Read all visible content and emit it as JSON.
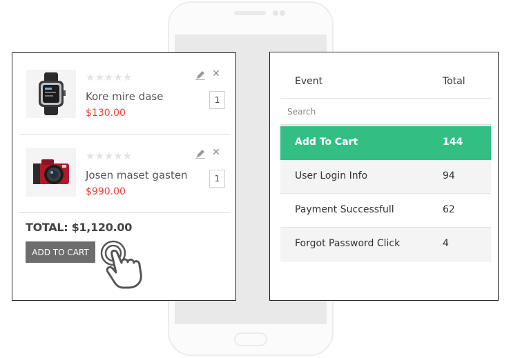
{
  "cart": {
    "items": [
      {
        "name": "Kore mire dase",
        "price": "$130.00",
        "quantity": "1",
        "rating": 0,
        "image_icon": "smartwatch-icon"
      },
      {
        "name": "Josen maset gasten",
        "price": "$990.00",
        "quantity": "1",
        "rating": 0,
        "image_icon": "camera-icon"
      }
    ],
    "total": "TOTAL: $1,120.00",
    "add_to_cart_label": "ADD TO CART",
    "stars_glyph": "★★★★★",
    "close_glyph": "✕",
    "edit_icon": "pencil-icon",
    "tap_icon": "hand-tap-icon"
  },
  "events": {
    "columns": [
      "Event",
      "Total"
    ],
    "search_placeholder": "Search",
    "rows": [
      {
        "event": "Add To Cart",
        "total": "144",
        "highlighted": true
      },
      {
        "event": "User Login Info",
        "total": "94"
      },
      {
        "event": "Payment Successfull",
        "total": "62"
      },
      {
        "event": "Forgot Password Click",
        "total": "4"
      }
    ]
  },
  "colors": {
    "highlight": "#33bf84",
    "price": "#e8403a",
    "button": "#6d6d6d"
  }
}
